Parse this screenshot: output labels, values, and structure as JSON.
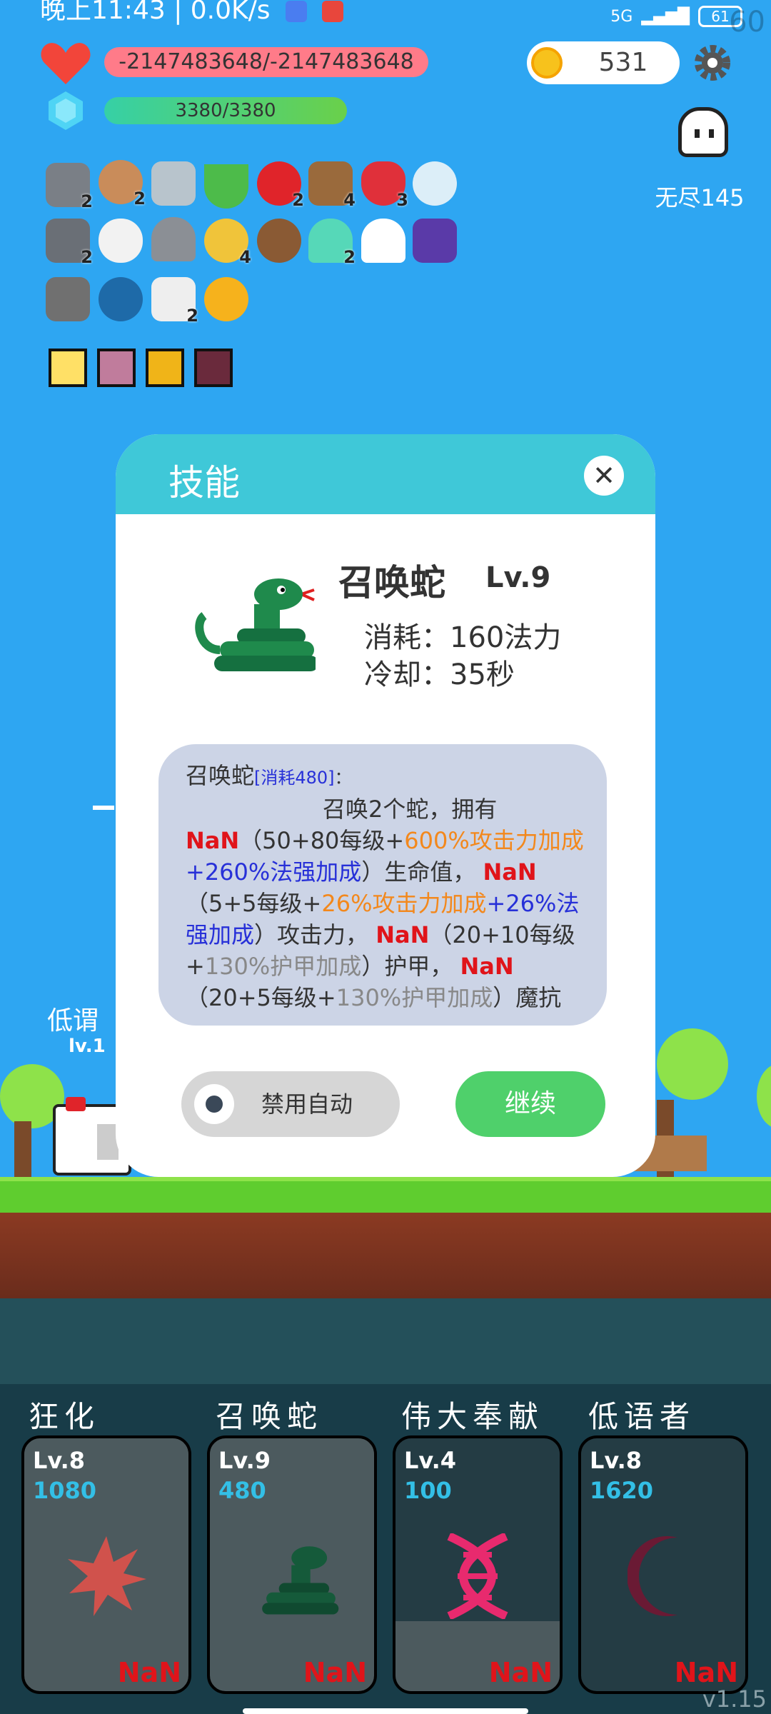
{
  "status_bar": {
    "time_speed": "晚上11:43 | 0.0K/s",
    "battery": "61",
    "network": "5G",
    "fps": "60"
  },
  "player": {
    "hp": "-2147483648/-2147483648",
    "mp": "3380/3380"
  },
  "coins": "531",
  "mode": {
    "label": "无尽145"
  },
  "items": {
    "badges": [
      "2",
      "2",
      "2",
      "4",
      "3",
      "2",
      "4",
      "2",
      "2"
    ]
  },
  "modal": {
    "title": "技能",
    "skill_name": "召唤蛇",
    "skill_level": "Lv.9",
    "cost": "消耗：160法力",
    "cooldown": "冷却：35秒",
    "desc": {
      "head": "召唤蛇",
      "cost_tag": "[消耗480]",
      "colon": "：",
      "intro": "召唤2个蛇，拥有",
      "nan": "NaN",
      "p1a": "（50+80每级+",
      "p1b": "600%攻击力加成",
      "p1c": "+260%法强加成",
      "p1d": "）生命值，",
      "p2a": "（5+5每级+",
      "p2b": "26%攻击力加成",
      "p2c": "+26%法强加成",
      "p2d": "）攻击力，",
      "p3a": "（20+10每级+",
      "p3b": "130%护甲加成",
      "p3c": "）护甲，",
      "p4a": "（20+5每级+",
      "p4b": "130%护甲加成",
      "p4c": "）魔抗"
    },
    "auto_label": "禁用自动",
    "continue_label": "继续"
  },
  "cards": [
    {
      "name": "狂化",
      "level": "Lv.8",
      "cost": "1080",
      "cd": "NaN"
    },
    {
      "name": "召唤蛇",
      "level": "Lv.9",
      "cost": "480",
      "cd": "NaN"
    },
    {
      "name": "伟大奉献",
      "level": "Lv.4",
      "cost": "100",
      "cd": "NaN"
    },
    {
      "name": "低语者",
      "level": "Lv.8",
      "cost": "1620",
      "cd": "NaN"
    }
  ],
  "behind_modal": {
    "name": "低谓",
    "level": "lv.1"
  },
  "version": "v1.15",
  "colors": {
    "sky": "#2ea6f2",
    "modal_header": "#3fc8d8",
    "continue": "#4fd06b",
    "nan": "#e0141a",
    "cost_blue": "#33bfe6"
  }
}
